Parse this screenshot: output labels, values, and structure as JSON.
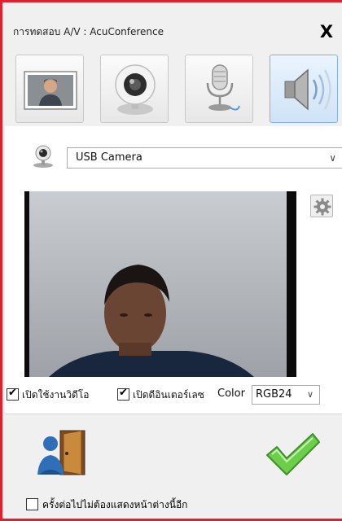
{
  "window": {
    "title": "การทดสอบ A/V : AcuConference",
    "close_label": "X",
    "border_color": "#e2202c"
  },
  "tabs": [
    {
      "icon": "user-photo-icon",
      "active": false
    },
    {
      "icon": "webcam-icon",
      "active": false
    },
    {
      "icon": "microphone-icon",
      "active": false
    },
    {
      "icon": "speaker-icon",
      "active": true
    }
  ],
  "camera": {
    "device_icon": "webcam-icon",
    "selected_device": "USB Camera",
    "settings_icon": "gear-icon"
  },
  "options": {
    "enable_video_label": "เปิดใช้งานวิดีโอ",
    "enable_video_checked": true,
    "enable_interlace_label": "เปิดดีอินเตอร์เลซ",
    "enable_interlace_checked": true,
    "color_label": "Color",
    "color_value": "RGB24"
  },
  "actions": {
    "exit_icon": "exit-door-icon",
    "ok_icon": "green-checkmark-icon"
  },
  "footer": {
    "dont_show_label": "ครั้งต่อไปไม่ต้องแสดงหน้าต่างนี้อีก",
    "dont_show_checked": false
  },
  "check_glyph": "✔",
  "dropdown_glyph": "∨"
}
